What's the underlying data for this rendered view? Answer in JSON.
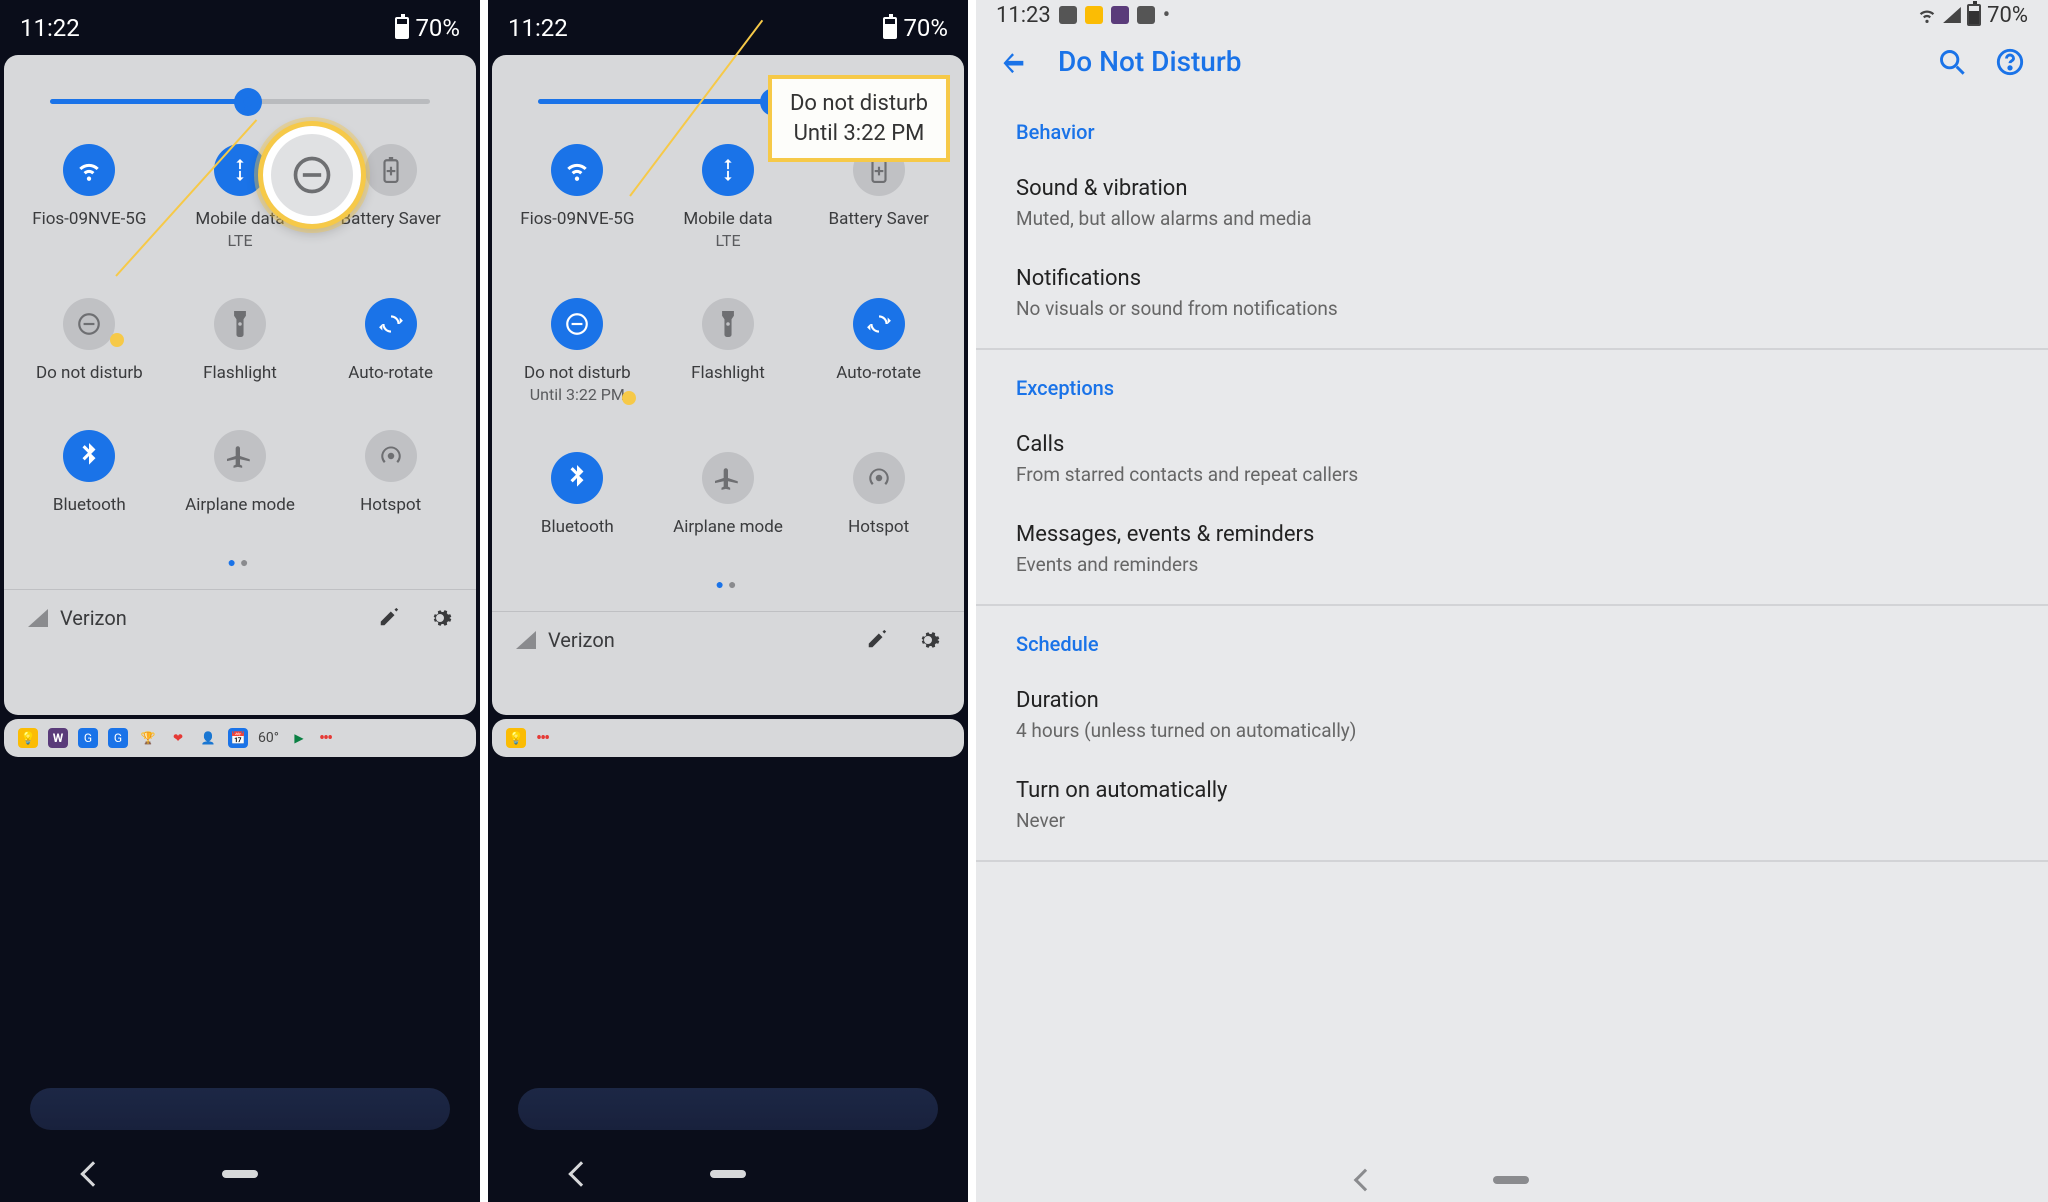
{
  "status_time_12": "11:22",
  "status_time_3": "11:23",
  "battery": "70%",
  "brightness_pct": 52,
  "tiles": {
    "wifi": "Fios-09NVE-5G",
    "mobile": "Mobile data",
    "mobile_sub": "LTE",
    "battery_saver": "Battery Saver",
    "dnd": "Do not disturb",
    "dnd_sub": "Until 3:22 PM",
    "flashlight": "Flashlight",
    "autorotate": "Auto-rotate",
    "bluetooth": "Bluetooth",
    "airplane": "Airplane mode",
    "hotspot": "Hotspot"
  },
  "carrier": "Verizon",
  "notif_temp": "60°",
  "callout1_l1": "Do not disturb",
  "callout1_l2": "Until 3:22 PM",
  "settings": {
    "title": "Do Not Disturb",
    "s1": "Behavior",
    "s1a_t": "Sound & vibration",
    "s1a_s": "Muted, but allow alarms and media",
    "s1b_t": "Notifications",
    "s1b_s": "No visuals or sound from notifications",
    "s2": "Exceptions",
    "s2a_t": "Calls",
    "s2a_s": "From starred contacts and repeat callers",
    "s2b_t": "Messages, events & reminders",
    "s2b_s": "Events and reminders",
    "s3": "Schedule",
    "s3a_t": "Duration",
    "s3a_s": "4 hours (unless turned on automatically)",
    "s3b_t": "Turn on automatically",
    "s3b_s": "Never"
  }
}
